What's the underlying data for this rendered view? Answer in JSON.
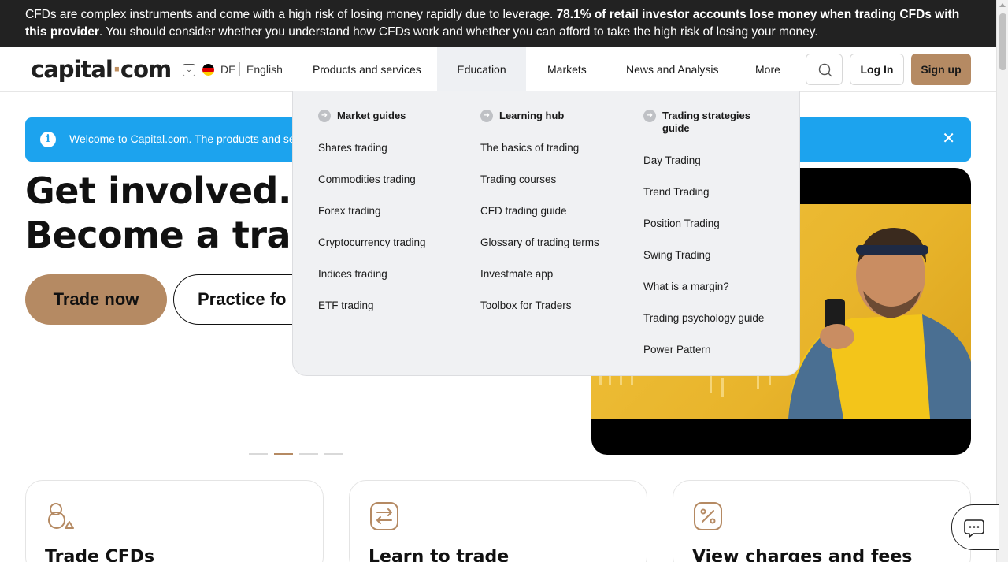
{
  "risk_banner": {
    "text_before": "CFDs are complex instruments and come with a high risk of losing money rapidly due to leverage. ",
    "bold": "78.1% of retail investor accounts lose money when trading CFDs with this provider",
    "text_after": ". You should consider whether you understand how CFDs work and whether you can afford to take the high risk of losing your money."
  },
  "header": {
    "logo_main": "capital",
    "logo_dot": "·",
    "logo_end": "com",
    "country_code": "DE",
    "language": "English",
    "nav": [
      "Products and services",
      "Education",
      "Markets",
      "News and Analysis",
      "More"
    ],
    "active_nav": "Education",
    "login": "Log In",
    "signup": "Sign up"
  },
  "welcome": {
    "message": "Welcome to Capital.com. The products and serv",
    "close": "✕"
  },
  "hero": {
    "line1": "Get involved.",
    "line2": "Become a trade",
    "trade_now": "Trade now",
    "practice": "Practice fo"
  },
  "carousel": {
    "count": 4,
    "active_index": 1
  },
  "mega_menu": {
    "columns": [
      {
        "heading": "Market guides",
        "links": [
          "Shares trading",
          "Commodities trading",
          "Forex trading",
          "Cryptocurrency trading",
          "Indices trading",
          "ETF trading"
        ]
      },
      {
        "heading": "Learning hub",
        "links": [
          "The basics of trading",
          "Trading courses",
          "CFD trading guide",
          "Glossary of trading terms",
          "Investmate app",
          "Toolbox for Traders"
        ]
      },
      {
        "heading_line1": "Trading strategies",
        "heading_line2": "guide",
        "links": [
          "Day Trading",
          "Trend Trading",
          "Position Trading",
          "Swing Trading",
          "What is a margin?",
          "Trading psychology guide",
          "Power Pattern"
        ]
      }
    ]
  },
  "cards": [
    {
      "title": "Trade CFDs",
      "icon": "circles-icon"
    },
    {
      "title": "Learn to trade",
      "icon": "swap-arrows-icon"
    },
    {
      "title": "View charges and fees",
      "icon": "percent-icon"
    }
  ],
  "colors": {
    "accent": "#b58a63",
    "banner_bg": "#222222",
    "welcome_bg": "#1ca3ee",
    "menu_bg": "#f0f1f3"
  }
}
